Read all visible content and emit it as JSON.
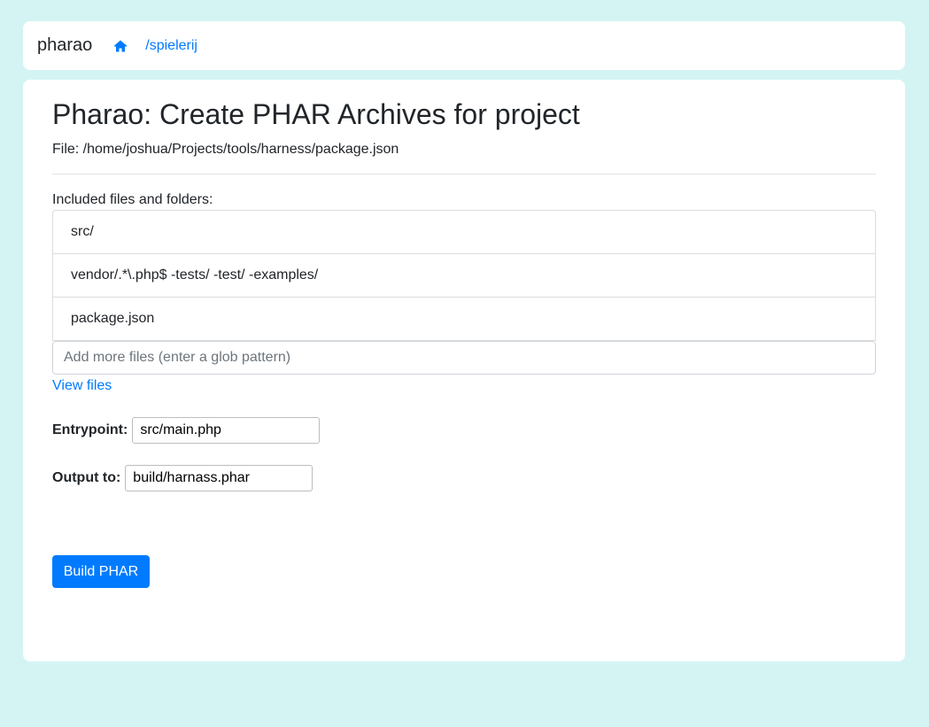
{
  "navbar": {
    "brand": "pharao",
    "home_icon": "home-icon",
    "breadcrumb": "/spielerij"
  },
  "main": {
    "title": "Pharao: Create PHAR Archives for project",
    "file_path": "File: /home/joshua/Projects/tools/harness/package.json",
    "included_label": "Included files and folders:",
    "included_items": [
      "src/",
      "vendor/.*\\.php$ -tests/ -test/ -examples/",
      "package.json"
    ],
    "add_placeholder": "Add more files (enter a glob pattern)",
    "view_files": "View files",
    "entrypoint_label": "Entrypoint:",
    "entrypoint_value": "src/main.php",
    "output_label": "Output to:",
    "output_value": "build/harnass.phar",
    "build_button": "Build PHAR"
  },
  "colors": {
    "background": "#d4f4f4",
    "accent": "#007bff"
  }
}
